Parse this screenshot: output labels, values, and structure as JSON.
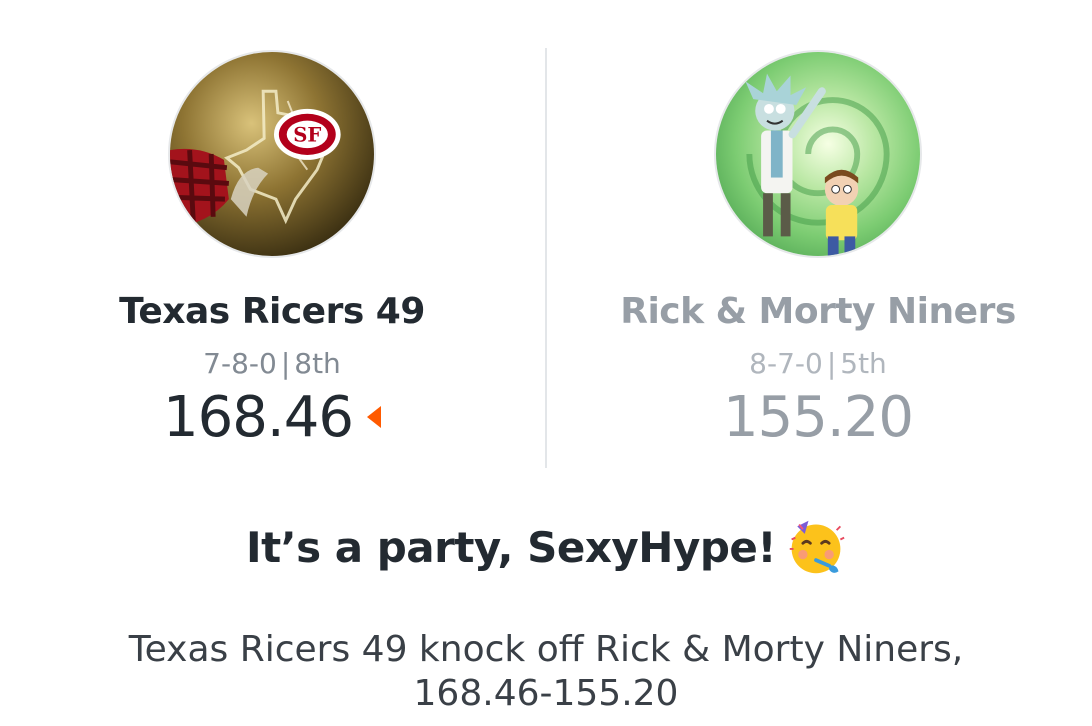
{
  "matchup": {
    "home": {
      "name": "Texas Ricers 49",
      "record": "7-8-0",
      "rank": "8th",
      "score": "168.46",
      "winner": true,
      "avatar_icon": "49ers-helmet-texas-avatar"
    },
    "away": {
      "name": "Rick & Morty Niners",
      "record": "8-7-0",
      "rank": "5th",
      "score": "155.20",
      "winner": false,
      "avatar_icon": "rick-and-morty-portal-avatar"
    },
    "separator": "|"
  },
  "result": {
    "headline": "It’s a party, SexyHype!",
    "emoji": "partying-face-icon",
    "summary_line1": "Texas Ricers 49 knock off Rick & Morty Niners,",
    "summary_line2": "168.46-155.20"
  },
  "colors": {
    "accent": "#ff5a00",
    "text_primary": "#232a31",
    "text_secondary": "#828a93",
    "text_muted": "#979ea6",
    "divider": "#e3e6e9"
  }
}
